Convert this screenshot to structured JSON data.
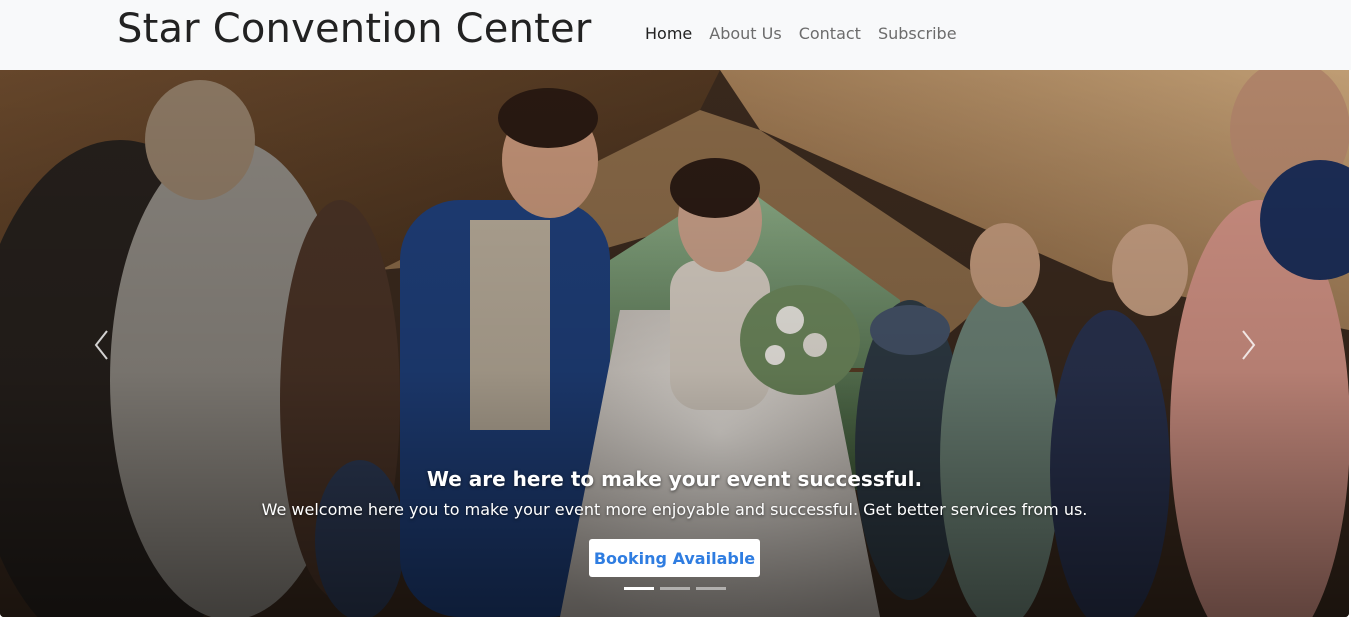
{
  "header": {
    "brand": "Star Convention Center",
    "nav": [
      {
        "label": "Home",
        "active": true
      },
      {
        "label": "About Us",
        "active": false
      },
      {
        "label": "Contact",
        "active": false
      },
      {
        "label": "Subscribe",
        "active": false
      }
    ]
  },
  "hero": {
    "image_icon": "wedding-photo",
    "title": "We are here to make your event successful.",
    "subtitle": "We welcome here you to make your event more enjoyable and successful. Get better services from us.",
    "button_label": "Booking Available",
    "prev_icon": "chevron-left-icon",
    "next_icon": "chevron-right-icon",
    "slides_count": 3,
    "active_slide": 1
  },
  "colors": {
    "navbar_bg": "#f8f9fa",
    "brand_text": "#222222",
    "nav_text": "#6c6c6c",
    "button_text": "#2f7de1"
  }
}
